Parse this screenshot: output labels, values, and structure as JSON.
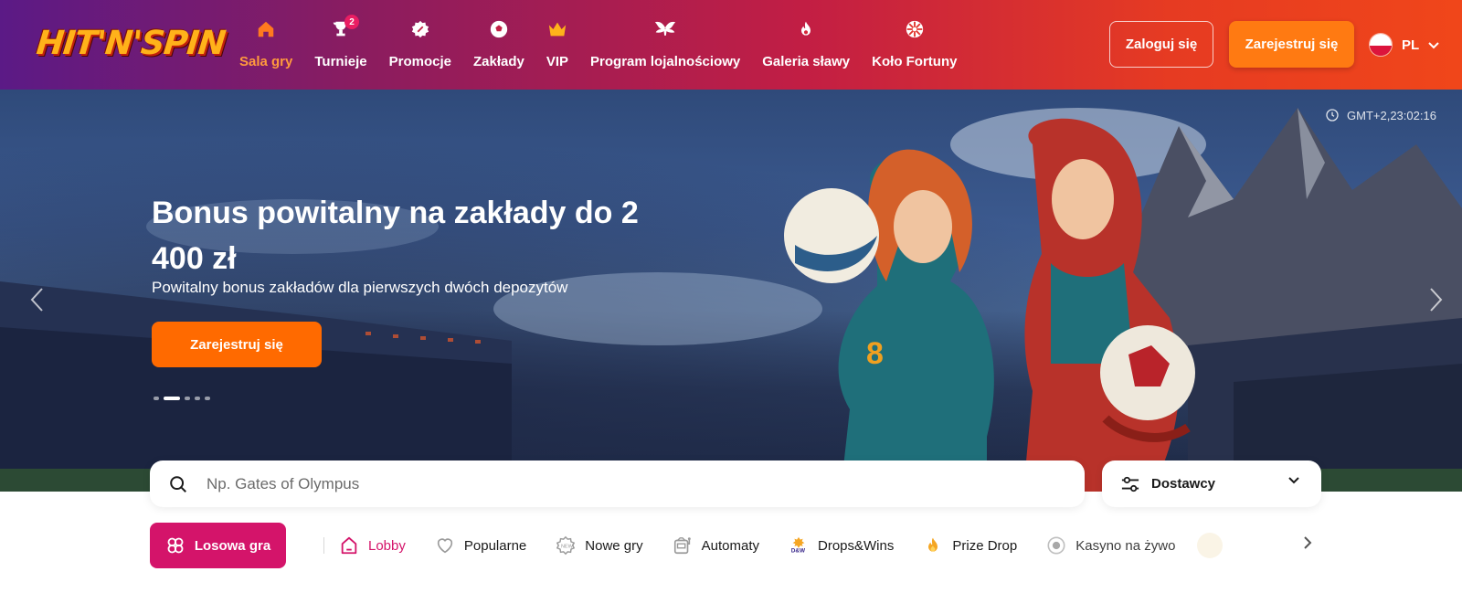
{
  "brand": {
    "logo_text": "HIT'N'SPIN"
  },
  "nav": [
    {
      "label": "Sala gry",
      "icon": "home-icon",
      "active": true
    },
    {
      "label": "Turnieje",
      "icon": "trophy-icon",
      "badge": "2"
    },
    {
      "label": "Promocje",
      "icon": "promo-icon"
    },
    {
      "label": "Zakłady",
      "icon": "football-icon"
    },
    {
      "label": "VIP",
      "icon": "crown-icon"
    },
    {
      "label": "Program lojalnościowy",
      "icon": "wings-icon"
    },
    {
      "label": "Galeria sławy",
      "icon": "flame-icon"
    },
    {
      "label": "Koło Fortuny",
      "icon": "wheel-icon"
    }
  ],
  "auth": {
    "login_label": "Zaloguj się",
    "register_label": "Zarejestruj się"
  },
  "language": {
    "code": "PL"
  },
  "hero": {
    "title": "Bonus powitalny na zakłady do 2 400 zł",
    "subtitle": "Powitalny bonus zakładów dla pierwszych dwóch depozytów",
    "cta_label": "Zarejestruj się",
    "time": "GMT+2,23:02:16",
    "slides": 5,
    "active_slide": 2
  },
  "search": {
    "placeholder": "Np. Gates of Olympus"
  },
  "providers": {
    "label": "Dostawcy"
  },
  "categories": {
    "random_label": "Losowa gra",
    "items": [
      {
        "label": "Lobby",
        "icon": "home-outline-icon",
        "active": true
      },
      {
        "label": "Popularne",
        "icon": "heart-icon"
      },
      {
        "label": "Nowe gry",
        "icon": "new-badge-icon"
      },
      {
        "label": "Automaty",
        "icon": "slot-machine-icon"
      },
      {
        "label": "Drops&Wins",
        "icon": "drops-wins-icon"
      },
      {
        "label": "Prize Drop",
        "icon": "flame-icon"
      },
      {
        "label": "Kasyno na żywo",
        "icon": "live-record-icon"
      }
    ]
  },
  "colors": {
    "accent_orange": "#ff6a00",
    "accent_pink": "#d4146a",
    "nav_active": "#ff9a3d"
  }
}
